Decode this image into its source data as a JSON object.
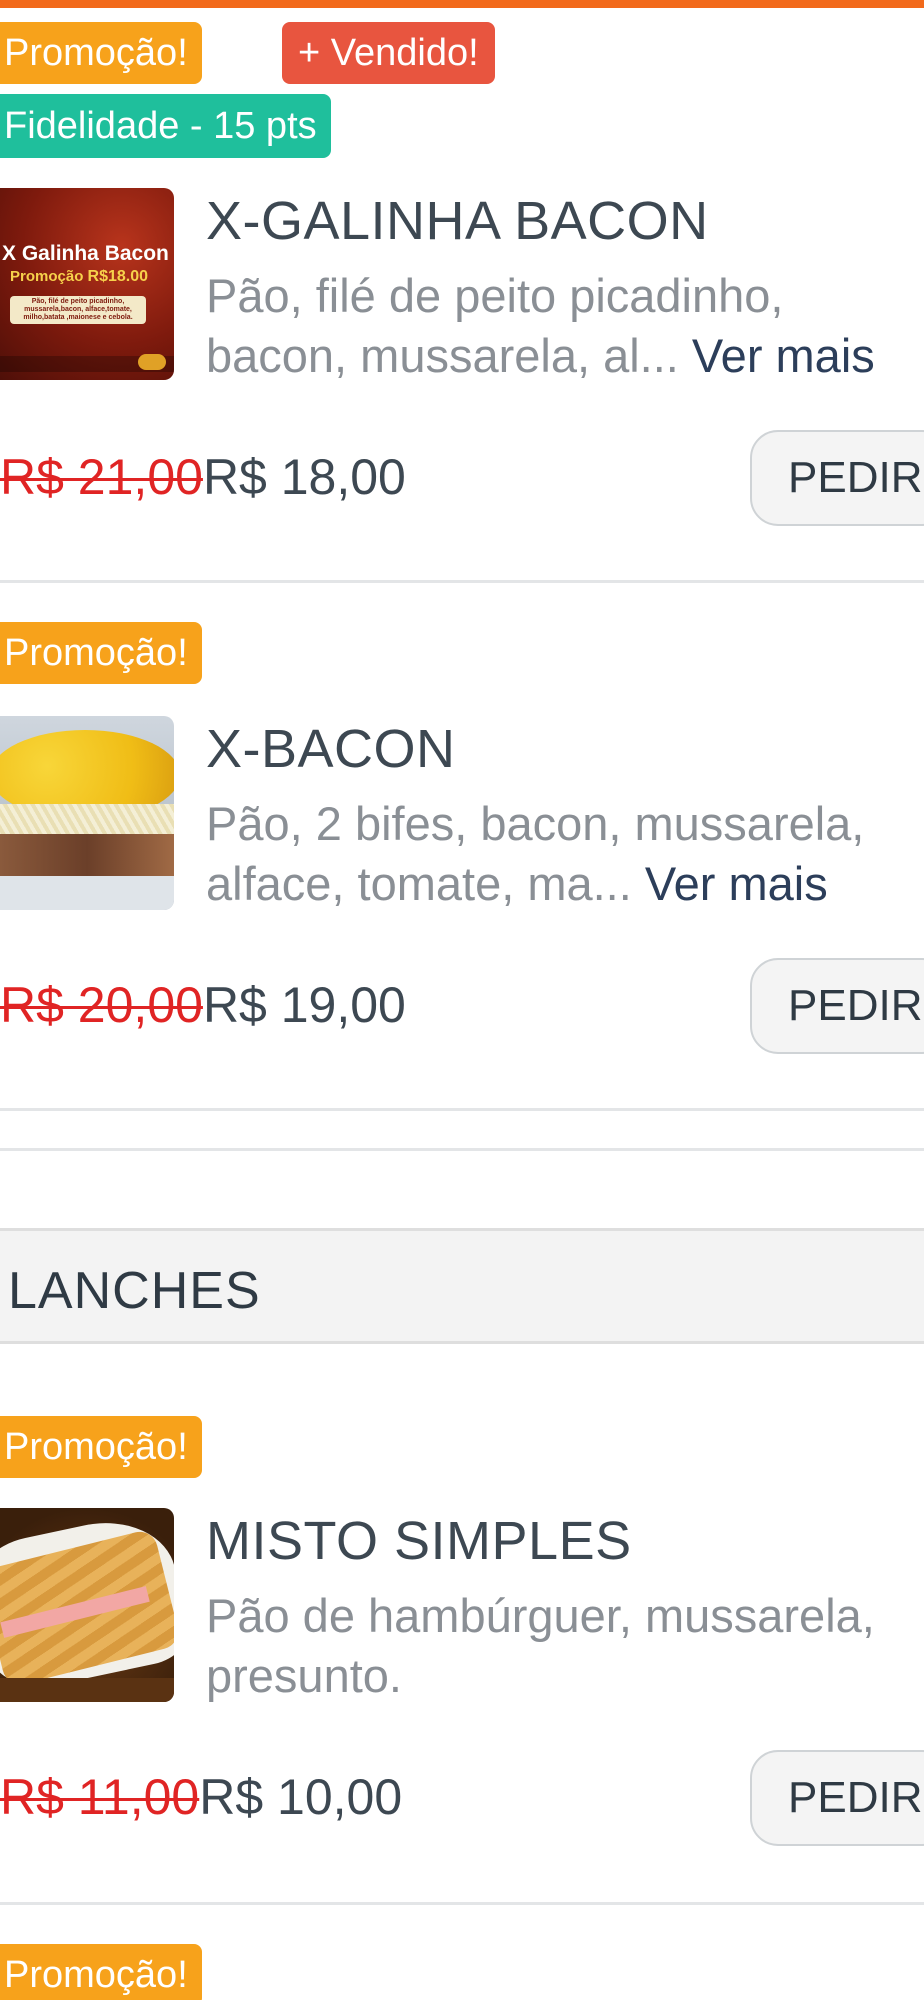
{
  "colors": {
    "accent": "#f26a1b",
    "promo": "#f7a21b",
    "vendido": "#e8553f",
    "fidelidade": "#1fbf9c",
    "old_price": "#e02424",
    "link": "#2c3e5a"
  },
  "badges": {
    "promo": "Promoção!",
    "vendido": "+ Vendido!",
    "fidelidade": "Fidelidade - 15 pts"
  },
  "section": {
    "title": "LANCHES"
  },
  "buttons": {
    "order_label": "PEDIR"
  },
  "items": [
    {
      "title": "X-GALINHA BACON",
      "desc": "Pão, filé de peito picadinho, bacon, mussarela, al...",
      "more": "Ver mais",
      "old_price": "R$ 21,00",
      "new_price": "R$ 18,00",
      "image": {
        "title": "X Galinha Bacon",
        "promo": "Promoção",
        "price": "R$18.00",
        "ingredients": "Pão, filé de peito picadinho, mussarela,bacon, alface,tomate, milho,batata ,maionese e cebola."
      }
    },
    {
      "title": "X-BACON",
      "desc": "Pão, 2 bifes, bacon, mussarela, alface, tomate, ma...",
      "more": "Ver mais",
      "old_price": "R$ 20,00",
      "new_price": "R$ 19,00"
    },
    {
      "title": "MISTO SIMPLES",
      "desc": "Pão de hambúrguer, mussarela, presunto.",
      "old_price": "R$ 11,00",
      "new_price": "R$ 10,00"
    }
  ]
}
